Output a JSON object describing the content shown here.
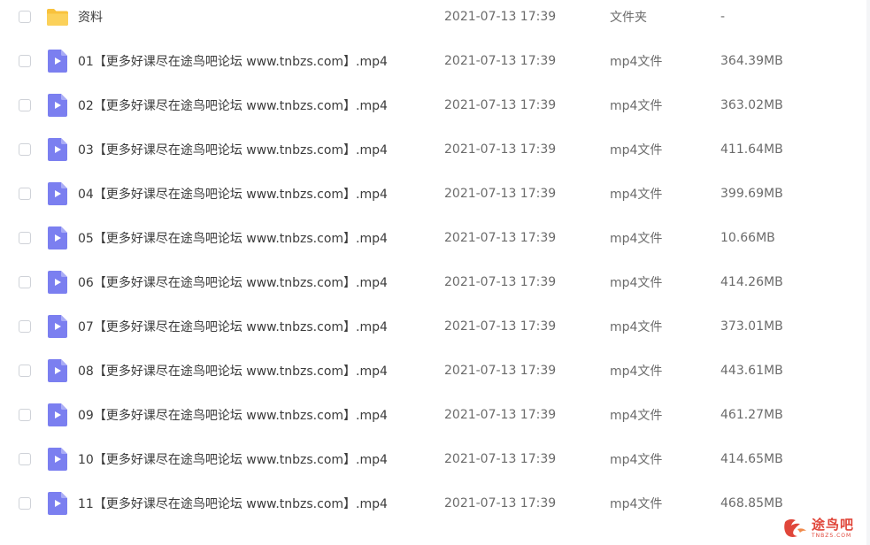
{
  "files": [
    {
      "name": "资料",
      "date": "2021-07-13 17:39",
      "type": "文件夹",
      "size": "-",
      "kind": "folder"
    },
    {
      "name": "01【更多好课尽在途鸟吧论坛 www.tnbzs.com】.mp4",
      "date": "2021-07-13 17:39",
      "type": "mp4文件",
      "size": "364.39MB",
      "kind": "video"
    },
    {
      "name": "02【更多好课尽在途鸟吧论坛 www.tnbzs.com】.mp4",
      "date": "2021-07-13 17:39",
      "type": "mp4文件",
      "size": "363.02MB",
      "kind": "video"
    },
    {
      "name": "03【更多好课尽在途鸟吧论坛 www.tnbzs.com】.mp4",
      "date": "2021-07-13 17:39",
      "type": "mp4文件",
      "size": "411.64MB",
      "kind": "video"
    },
    {
      "name": "04【更多好课尽在途鸟吧论坛 www.tnbzs.com】.mp4",
      "date": "2021-07-13 17:39",
      "type": "mp4文件",
      "size": "399.69MB",
      "kind": "video"
    },
    {
      "name": "05【更多好课尽在途鸟吧论坛 www.tnbzs.com】.mp4",
      "date": "2021-07-13 17:39",
      "type": "mp4文件",
      "size": "10.66MB",
      "kind": "video"
    },
    {
      "name": "06【更多好课尽在途鸟吧论坛 www.tnbzs.com】.mp4",
      "date": "2021-07-13 17:39",
      "type": "mp4文件",
      "size": "414.26MB",
      "kind": "video"
    },
    {
      "name": "07【更多好课尽在途鸟吧论坛 www.tnbzs.com】.mp4",
      "date": "2021-07-13 17:39",
      "type": "mp4文件",
      "size": "373.01MB",
      "kind": "video"
    },
    {
      "name": "08【更多好课尽在途鸟吧论坛 www.tnbzs.com】.mp4",
      "date": "2021-07-13 17:39",
      "type": "mp4文件",
      "size": "443.61MB",
      "kind": "video"
    },
    {
      "name": "09【更多好课尽在途鸟吧论坛 www.tnbzs.com】.mp4",
      "date": "2021-07-13 17:39",
      "type": "mp4文件",
      "size": "461.27MB",
      "kind": "video"
    },
    {
      "name": "10【更多好课尽在途鸟吧论坛 www.tnbzs.com】.mp4",
      "date": "2021-07-13 17:39",
      "type": "mp4文件",
      "size": "414.65MB",
      "kind": "video"
    },
    {
      "name": "11【更多好课尽在途鸟吧论坛 www.tnbzs.com】.mp4",
      "date": "2021-07-13 17:39",
      "type": "mp4文件",
      "size": "468.85MB",
      "kind": "video"
    }
  ],
  "icons": {
    "folder": "folder-icon",
    "video": "video-file-icon"
  },
  "colors": {
    "folder": "#f8c23c",
    "video_file": "#7b7ff0",
    "watermark": "#e0463a"
  },
  "watermark": {
    "main": "途鸟吧",
    "sub": "TNBZS.COM"
  }
}
